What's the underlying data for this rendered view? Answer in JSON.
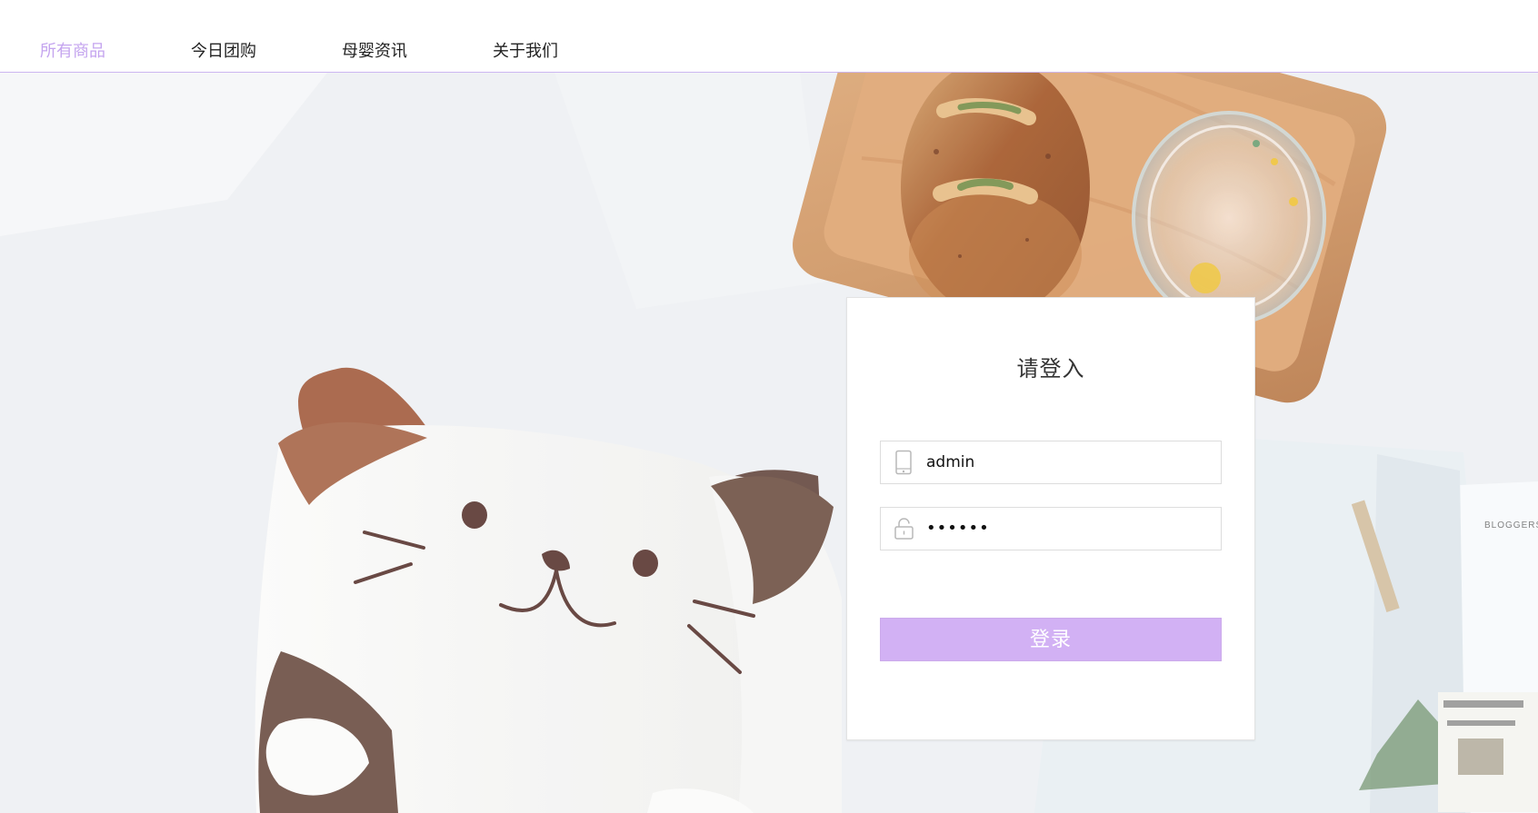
{
  "navigation": {
    "items": [
      {
        "label": "所有商品",
        "active": true
      },
      {
        "label": "今日团购",
        "active": false
      },
      {
        "label": "母婴资讯",
        "active": false
      },
      {
        "label": "关于我们",
        "active": false
      }
    ]
  },
  "login": {
    "title": "请登入",
    "username": {
      "value": "admin",
      "icon": "phone-icon"
    },
    "password": {
      "value": "••••••",
      "icon": "lock-icon"
    },
    "button_label": "登录"
  },
  "hero": {
    "image": "cat-bread-tableware-photo",
    "magazine_text": "BLOGGERS"
  },
  "colors": {
    "accent": "#c4a4ef",
    "button": "#d2b1f4",
    "nav_border": "#ccb6f1"
  }
}
